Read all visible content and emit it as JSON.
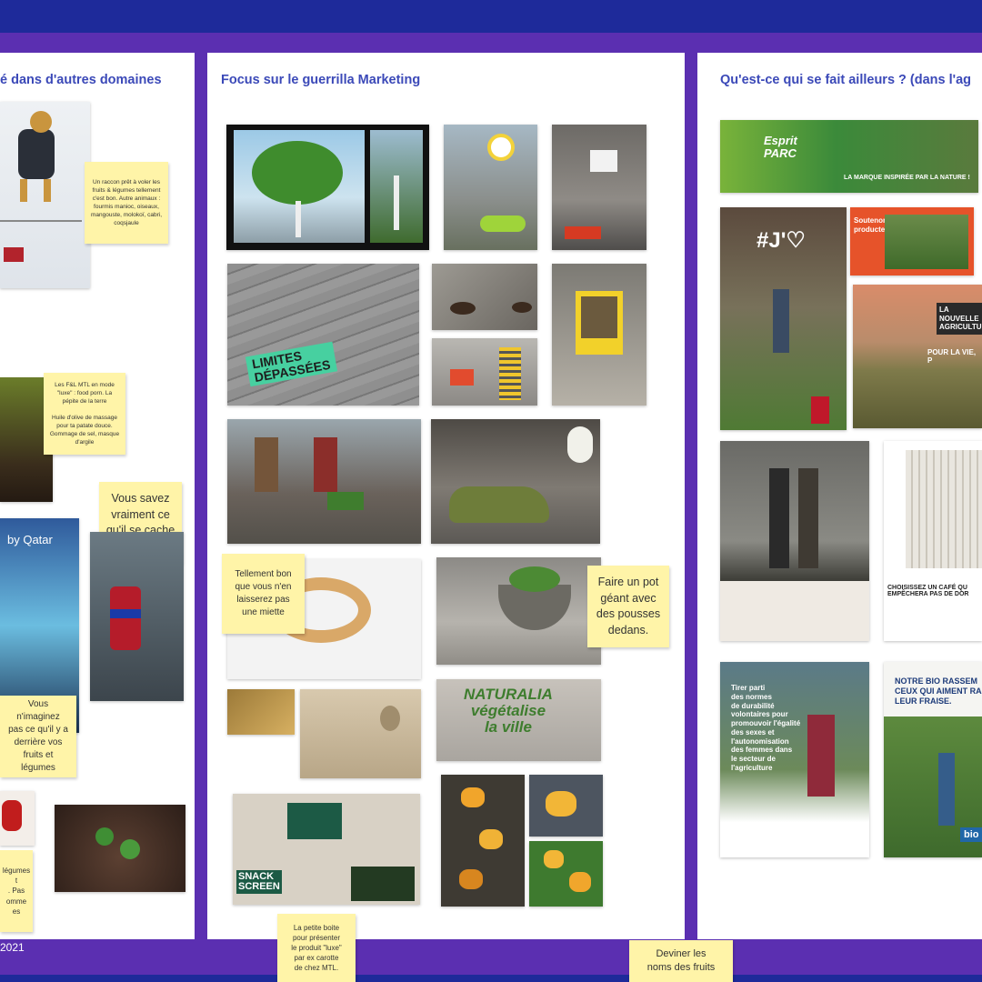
{
  "panels": {
    "left_title": "é dans d'autres domaines",
    "center_title": "Focus sur le guerrilla Marketing",
    "right_title": "Qu'est-ce qui se fait ailleurs ? (dans l'ag"
  },
  "footer": {
    "year": "2021"
  },
  "stickies": {
    "raccoon": "Un raccon prêt à voler les\nfruits & légumes tellement\nc'est bon. Autre animaux :\nfourmis manioc, oiseaux,\nmangouste, molokoï, cabri,\ncoqsjaule",
    "feel": "Les F&L MTL en mode\n\"luxe\" : food porn. La\npépite de la terre\n\nHuile d'olive de massage\npour ta patate douce.\nGommage de sel, masque\nd'argile",
    "savez": "Vous savez\nvraiment ce\nqu'il se cache\nderrière",
    "imaginez": "Vous n'imaginez\npas ce qu'il y a\nderrière vos\nfruits et\nlégumes",
    "legumes": "légumes\nt\n. Pas\nomme\nes",
    "tellement": "Tellement bon\nque vous n'en\nlaisserez pas\nune miette",
    "pot": "Faire un pot\ngéant avec\ndes pousses\ndedans.",
    "boite": "La petite boite\npour présenter\nle produit \"luxe\"\npar ex carotte\nde chez MTL.",
    "deviner": "Deviner les\nnoms des fruits"
  },
  "image_text": {
    "limites": "LIMITES\nDÉPASSÉES",
    "by_qatar": "by Qatar",
    "naturalia": "NATURALIA\nvégétalise\nla ville",
    "snack": "SNACK\nSCREEN",
    "esprit_parc": "Esprit\nPARC",
    "esprit_sub": "LA MARQUE INSPIRÉE PAR LA NATURE !",
    "jaime": "#J'♡",
    "soutenons": "Soutenons nos\nproducteurs locaux",
    "nouvelle": "LA\nNOUVELLE\nAGRICULTURE",
    "pour_la_vie": "POUR LA VIE, P",
    "cafe": "CHOISISSEZ UN CAFÉ QU\nEMPÊCHERA PAS DE DOR",
    "tirer": "Tirer parti\ndes normes\nde durabilité\nvolontaires pour\npromouvoir l'égalité\ndes sexes et\nl'autonomisation\ndes femmes dans\nle secteur de\nl'agriculture",
    "notre_bio": "NOTRE BIO RASSEM\nCEUX QUI AIMENT RA\nLEUR FRAISE.",
    "bio": "bio"
  }
}
